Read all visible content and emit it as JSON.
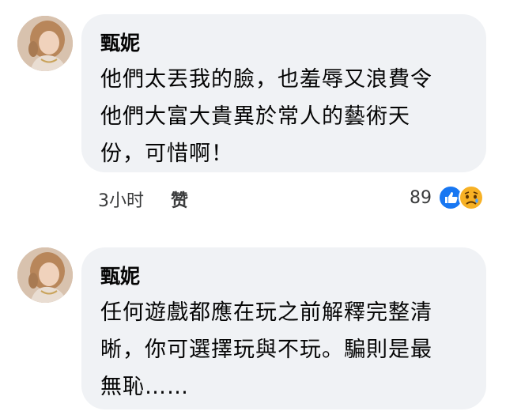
{
  "comments": [
    {
      "author": "甄妮",
      "lines": [
        "他們太丟我的臉，也羞辱又浪費令",
        "他們大富大貴異於常人的藝術天",
        "份，可惜啊！"
      ],
      "time": "3小时",
      "like_label": "赞",
      "reaction_count": "89",
      "reaction_icons": [
        "like-icon",
        "sad-icon"
      ]
    },
    {
      "author": "甄妮",
      "lines": [
        "任何遊戲都應在玩之前解釋完整清",
        "晰，你可選擇玩與不玩。騙則是最",
        "無恥……"
      ]
    }
  ],
  "colors": {
    "bubble": "#f0f2f5",
    "like_blue": "#1877f2",
    "sad_yellow": "#f7b125"
  }
}
